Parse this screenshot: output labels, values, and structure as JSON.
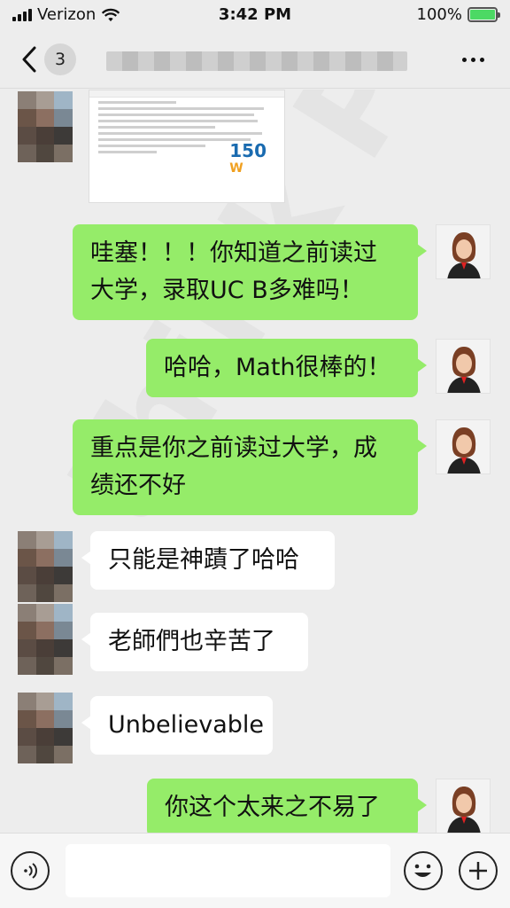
{
  "status_bar": {
    "carrier": "Verizon",
    "time": "3:42 PM",
    "battery": "100%",
    "battery_color": "#4cd964"
  },
  "nav": {
    "back_icon": "chevron-left-icon",
    "unread_count": "3",
    "more_icon": "more-dots-icon"
  },
  "messages": [
    {
      "side": "left",
      "type": "image"
    },
    {
      "side": "right",
      "type": "text",
      "text": "哇塞！！！你知道之前读过大学，录取UC B多难吗！"
    },
    {
      "side": "right",
      "type": "text",
      "text": "哈哈，Math很棒的！"
    },
    {
      "side": "right",
      "type": "text",
      "text": "重点是你之前读过大学，成绩还不好"
    },
    {
      "side": "left",
      "type": "text",
      "text": "只能是神蹟了哈哈"
    },
    {
      "side": "left",
      "type": "text",
      "text": "老師們也辛苦了"
    },
    {
      "side": "left",
      "type": "text",
      "text": "Unbelievable"
    },
    {
      "side": "right",
      "type": "text",
      "text": "你这个太来之不易了"
    }
  ],
  "image_message": {
    "logo_text": "150"
  },
  "input_bar": {
    "voice_icon": "voice-icon",
    "emoji_icon": "emoji-icon",
    "plus_icon": "plus-icon",
    "input_value": ""
  },
  "colors": {
    "sent_bubble": "#95ec69",
    "received_bubble": "#ffffff",
    "background": "#ededed"
  }
}
